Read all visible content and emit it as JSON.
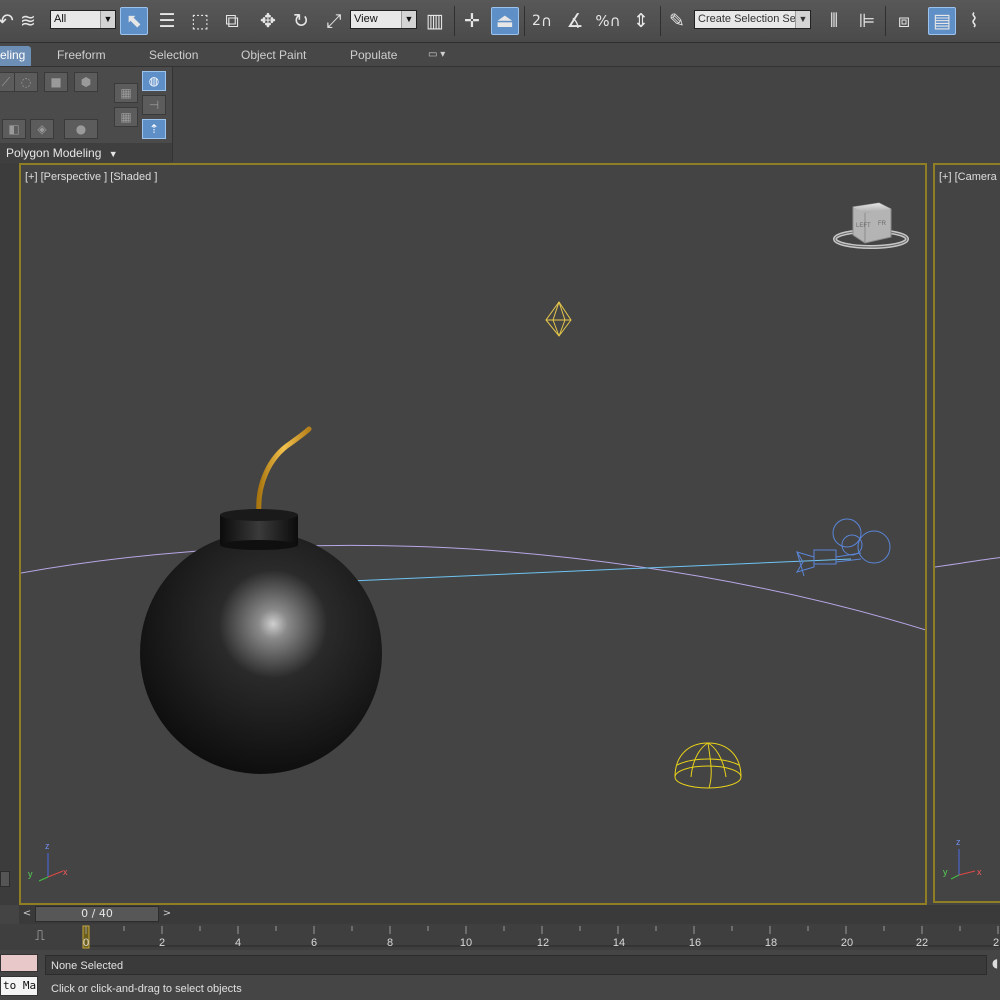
{
  "toolbar": {
    "selection_filter": "All",
    "reference_coordinate": "View",
    "snap_value": "2",
    "named_selection_placeholder": "Create Selection Se",
    "icons": [
      "undo-icon",
      "redo-icon",
      "link-icon",
      "select-object-icon",
      "select-by-name-icon",
      "rectangular-region-icon",
      "window-crossing-icon",
      "move-icon",
      "rotate-icon",
      "scale-icon",
      "pivot-icon",
      "select-manipulate-icon",
      "keyboard-shortcut-icon",
      "snap-toggle-icon",
      "angle-snap-icon",
      "percent-snap-icon",
      "spinner-snap-icon",
      "edit-named-selection-icon",
      "mirror-icon",
      "align-icon",
      "layer-explorer-icon",
      "scene-explorer-icon",
      "curve-editor-icon"
    ]
  },
  "ribbon": {
    "tabs": [
      {
        "label": "eling",
        "active": true
      },
      {
        "label": "Freeform",
        "active": false
      },
      {
        "label": "Selection",
        "active": false
      },
      {
        "label": "Object Paint",
        "active": false
      },
      {
        "label": "Populate",
        "active": false
      }
    ],
    "panel_label": "Polygon Modeling"
  },
  "viewports": {
    "main_label": "[+] [Perspective ] [Shaded ]",
    "side_label": "[+] [Camera"
  },
  "time_slider": {
    "frame_display": "0 / 40",
    "tick_labels": [
      "0",
      "2",
      "4",
      "6",
      "8",
      "10",
      "12",
      "14",
      "16",
      "18",
      "20",
      "22",
      "2"
    ]
  },
  "status": {
    "selection_status": "None Selected",
    "prompt": "Click or click-and-drag to select objects",
    "maxscript_listener": "to Ma"
  },
  "colors": {
    "viewport_border": "#8f7e23",
    "active_blue": "#5f8fc7",
    "gizmo_yellow": "#e8c94a",
    "camera_blue": "#5a85d8"
  }
}
